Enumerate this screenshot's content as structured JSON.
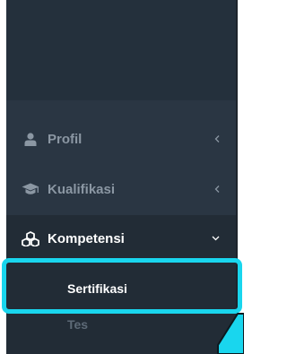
{
  "sidebar": {
    "items": [
      {
        "label": "Profil",
        "icon": "user-icon",
        "chevron": "chevron-left-icon",
        "active": false
      },
      {
        "label": "Kualifikasi",
        "icon": "graduation-cap-icon",
        "chevron": "chevron-left-icon",
        "active": false
      },
      {
        "label": "Kompetensi",
        "icon": "cubes-icon",
        "chevron": "chevron-down-icon",
        "active": true
      }
    ],
    "submenu": [
      {
        "label": "Sertifikasi",
        "highlighted": true
      },
      {
        "label": "Tes",
        "highlighted": false
      }
    ]
  },
  "colors": {
    "sidebar_bg": "#2a3643",
    "header_bg": "#24303c",
    "active_bg": "#222c36",
    "inactive_text": "#8b97a3",
    "active_text": "#ffffff",
    "highlight": "#19d6ee"
  }
}
